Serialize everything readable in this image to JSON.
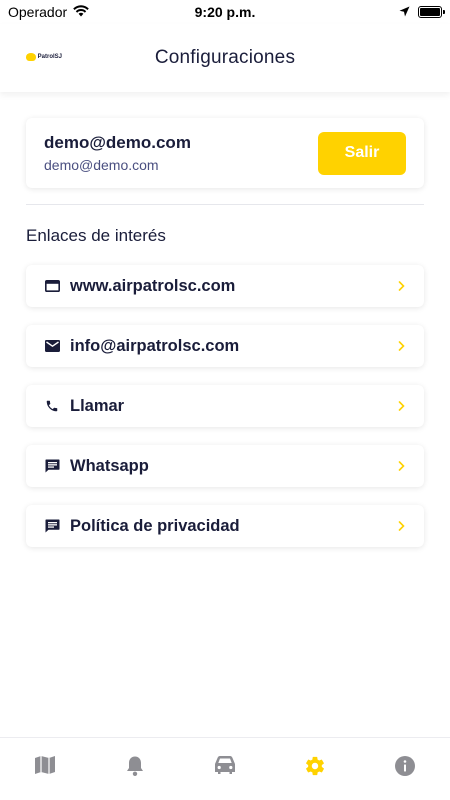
{
  "status_bar": {
    "carrier": "Operador",
    "time": "9:20 p.m."
  },
  "header": {
    "logo_text": "PatrolSJ",
    "title": "Configuraciones"
  },
  "account": {
    "email_main": "demo@demo.com",
    "email_sub": "demo@demo.com",
    "logout_label": "Salir"
  },
  "links_section": {
    "title": "Enlaces de interés",
    "items": [
      {
        "label": "www.airpatrolsc.com",
        "icon": "browser-icon"
      },
      {
        "label": "info@airpatrolsc.com",
        "icon": "mail-icon"
      },
      {
        "label": "Llamar",
        "icon": "phone-icon"
      },
      {
        "label": "Whatsapp",
        "icon": "chat-icon"
      },
      {
        "label": "Política de privacidad",
        "icon": "chat-icon"
      }
    ]
  },
  "tab_bar": {
    "tabs": [
      {
        "icon": "map-icon",
        "active": false
      },
      {
        "icon": "bell-icon",
        "active": false
      },
      {
        "icon": "car-icon",
        "active": false
      },
      {
        "icon": "gear-icon",
        "active": true
      },
      {
        "icon": "info-icon",
        "active": false
      }
    ]
  },
  "colors": {
    "accent": "#ffd200",
    "text_dark": "#1a1d3a",
    "text_muted": "#4a4f80",
    "tab_inactive": "#8e8e93"
  }
}
